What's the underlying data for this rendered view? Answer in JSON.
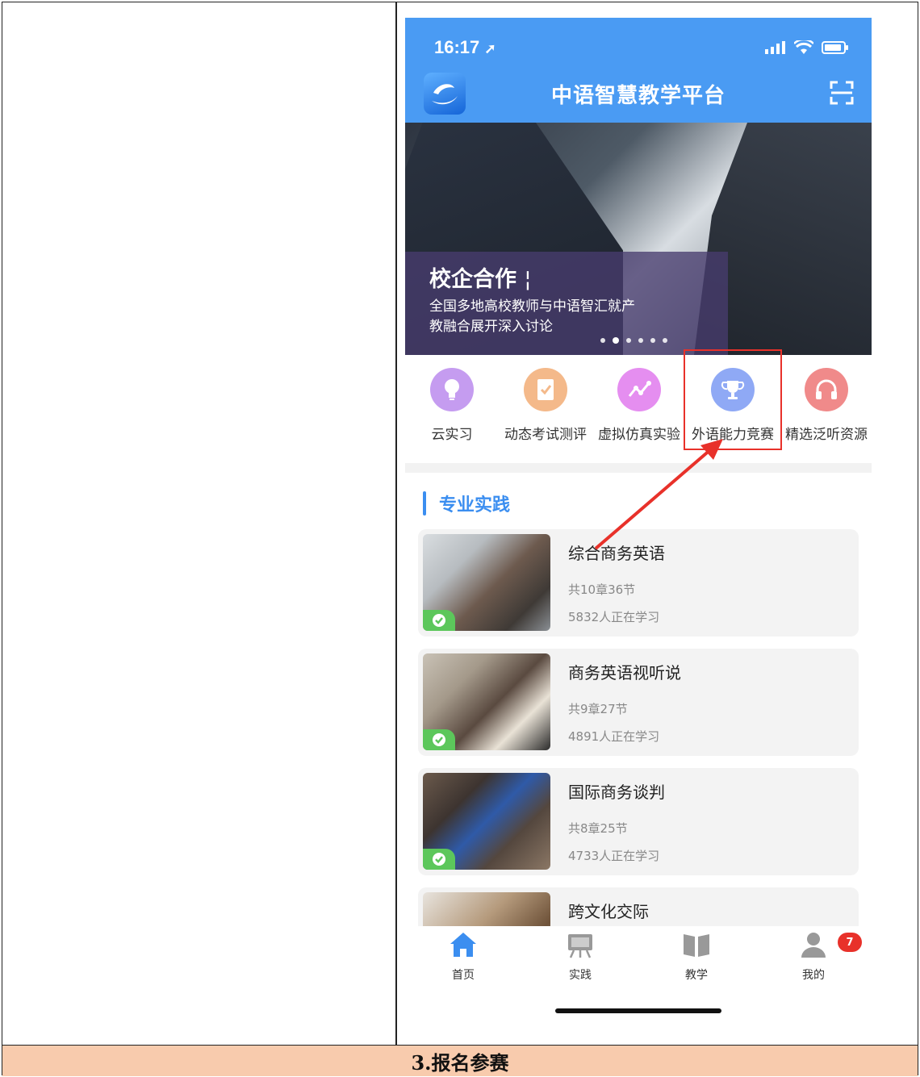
{
  "status_bar": {
    "time": "16:17"
  },
  "header": {
    "title": "中语智慧教学平台"
  },
  "banner": {
    "title": "校企合作",
    "subtitle": "全国多地高校教师与中语智汇就产教融合展开深入讨论"
  },
  "quick_menu": [
    {
      "label": "云实习",
      "icon": "lightbulb-icon",
      "color": "#c59cf0"
    },
    {
      "label": "动态考试测评",
      "icon": "exam-paper-icon",
      "color": "#f4b98a"
    },
    {
      "label": "虚拟仿真实验",
      "icon": "chart-line-icon",
      "color": "#e58ef0"
    },
    {
      "label": "外语能力竞赛",
      "icon": "trophy-icon",
      "color": "#8fa9f5"
    },
    {
      "label": "精选泛听资源",
      "icon": "headphones-icon",
      "color": "#f08a8a"
    }
  ],
  "section": {
    "title": "专业实践"
  },
  "courses": [
    {
      "title": "综合商务英语",
      "chapters": "共10章36节",
      "learners": "5832人正在学习"
    },
    {
      "title": "商务英语视听说",
      "chapters": "共9章27节",
      "learners": "4891人正在学习"
    },
    {
      "title": "国际商务谈判",
      "chapters": "共8章25节",
      "learners": "4733人正在学习"
    },
    {
      "title": "跨文化交际",
      "chapters": "",
      "learners": ""
    }
  ],
  "tabbar": [
    {
      "label": "首页",
      "icon": "home-icon",
      "active": true
    },
    {
      "label": "实践",
      "icon": "easel-icon",
      "active": false
    },
    {
      "label": "教学",
      "icon": "book-icon",
      "active": false
    },
    {
      "label": "我的",
      "icon": "user-icon",
      "active": false
    }
  ],
  "notification_badge": "7",
  "footer": {
    "step_label": "3.报名参赛"
  },
  "colors": {
    "accent": "#4a9bf3",
    "highlight": "#e8312a",
    "footer_bg": "#f8cbad"
  }
}
